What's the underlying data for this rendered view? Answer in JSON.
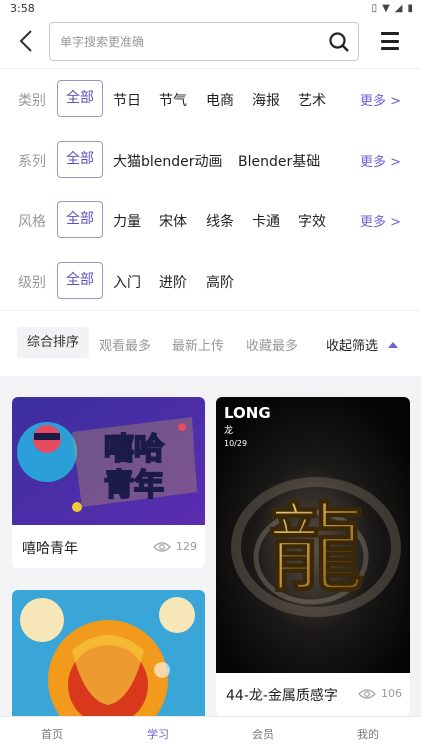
{
  "status_bar": {
    "time": "3:58"
  },
  "search": {
    "placeholder": "单字搜索更准确"
  },
  "filters": [
    {
      "label": "类别",
      "options": [
        "全部",
        "节日",
        "节气",
        "电商",
        "海报",
        "艺术"
      ],
      "active": 0,
      "more": "更多 >"
    },
    {
      "label": "系列",
      "options": [
        "全部",
        "大猫blender动画",
        "Blender基础"
      ],
      "active": 0,
      "more": "更多 >"
    },
    {
      "label": "风格",
      "options": [
        "全部",
        "力量",
        "宋体",
        "线条",
        "卡通",
        "字效"
      ],
      "active": 0,
      "more": "更多 >"
    },
    {
      "label": "级别",
      "options": [
        "全部",
        "入门",
        "进阶",
        "高阶"
      ],
      "active": 0,
      "more": ""
    }
  ],
  "sort": {
    "options": [
      "综合排序",
      "观看最多",
      "最新上传",
      "收藏最多"
    ],
    "active": 0,
    "collapse_label": "收起筛选"
  },
  "cards": [
    {
      "title": "嘻哈青年",
      "views": "129",
      "image_text": "嘻哈青年"
    },
    {
      "title": "44-龙-金属质感字",
      "views": "106",
      "image_text": "龍",
      "poster_header": "LONG",
      "poster_sub": "龙",
      "poster_date": "10/29"
    },
    {
      "title": "",
      "views": "",
      "image_text": ""
    }
  ],
  "nav": [
    {
      "label": "首页",
      "active": false
    },
    {
      "label": "学习",
      "active": true
    },
    {
      "label": "会员",
      "active": false
    },
    {
      "label": "我的",
      "active": false
    }
  ],
  "colors": {
    "accent": "#6b62d6",
    "active_border": "#9a96c9",
    "muted": "#999999",
    "content_bg": "#f3f3f5"
  }
}
